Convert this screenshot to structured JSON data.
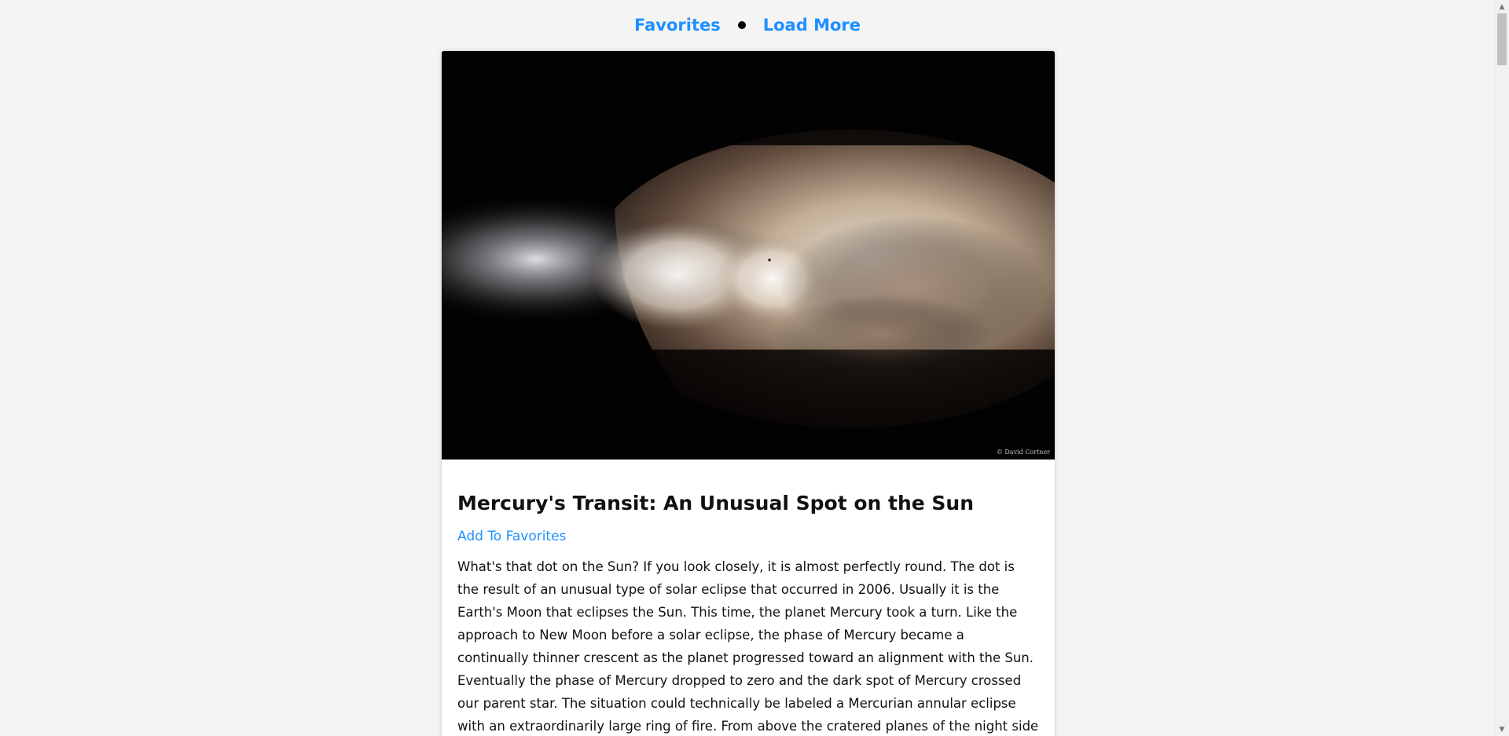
{
  "nav": {
    "favorites_label": "Favorites",
    "load_more_label": "Load More"
  },
  "article": {
    "photo_credit": "© David Cortner",
    "title": "Mercury's Transit: An Unusual Spot on the Sun",
    "add_favorite_label": "Add To Favorites",
    "description": "What's that dot on the Sun? If you look closely, it is almost perfectly round. The dot is the result of an unusual type of solar eclipse that occurred in 2006. Usually it is the Earth's Moon that eclipses the Sun. This time, the planet Mercury took a turn. Like the approach to New Moon before a solar eclipse, the phase of Mercury became a continually thinner crescent as the planet progressed toward an alignment with the Sun. Eventually the phase of Mercury dropped to zero and the dark spot of Mercury crossed our parent star. The situation could technically be labeled a Mercurian annular eclipse with an extraordinarily large ring of fire. From above the cratered planes of the night side of Mercury, the Earth"
  },
  "colors": {
    "link": "#1e90ff",
    "background": "#f4f4f4",
    "card": "#ffffff"
  }
}
